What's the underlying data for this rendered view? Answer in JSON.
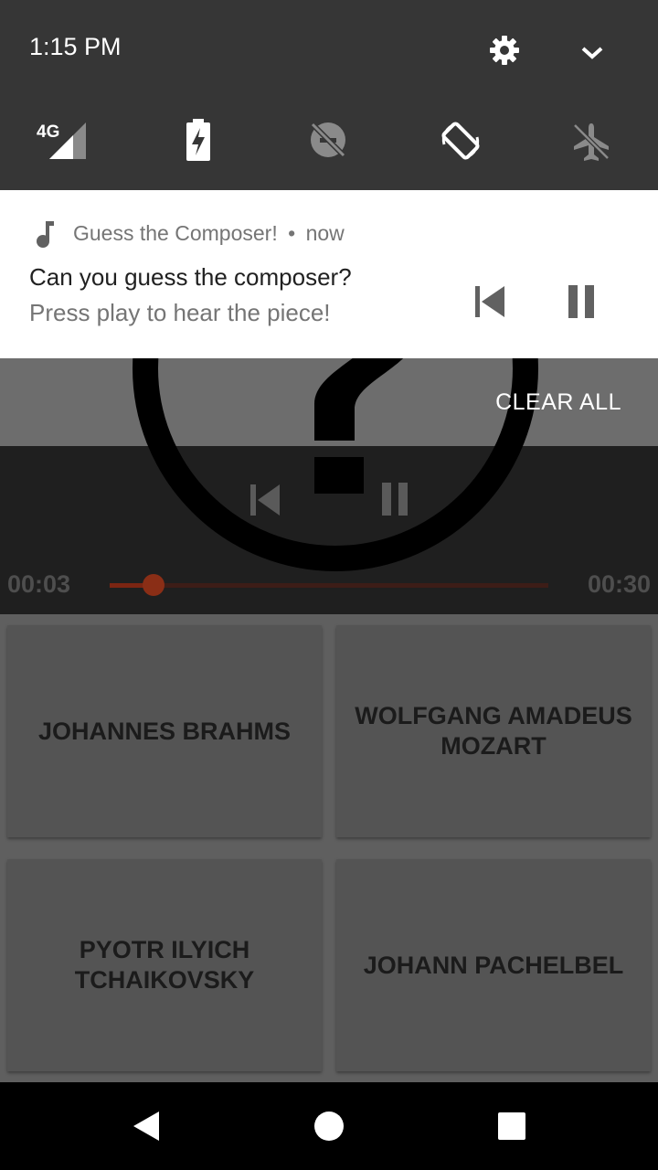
{
  "status_bar": {
    "time": "1:15 PM",
    "network_label": "4G",
    "icons": [
      "settings-icon",
      "expand-chevron-icon",
      "signal-4g-icon",
      "battery-charging-icon",
      "data-saver-off-icon",
      "auto-rotate-icon",
      "airplane-mode-off-icon"
    ]
  },
  "notification": {
    "app_name": "Guess the Composer!",
    "separator": "•",
    "when": "now",
    "title": "Can you guess the composer?",
    "text": "Press play to hear the piece!",
    "icons": [
      "music-note-icon",
      "skip-previous-icon",
      "pause-icon"
    ]
  },
  "shade": {
    "clear_all_label": "CLEAR ALL"
  },
  "player": {
    "elapsed": "00:03",
    "duration": "00:30",
    "progress_fraction": 0.1,
    "accent_color": "#8a2e16"
  },
  "answers": [
    "JOHANNES BRAHMS",
    "WOLFGANG AMADEUS MOZART",
    "PYOTR ILYICH TCHAIKOVSKY",
    "JOHANN PACHELBEL"
  ],
  "nav_bar": {
    "icons": [
      "back-icon",
      "home-icon",
      "recents-icon"
    ]
  }
}
